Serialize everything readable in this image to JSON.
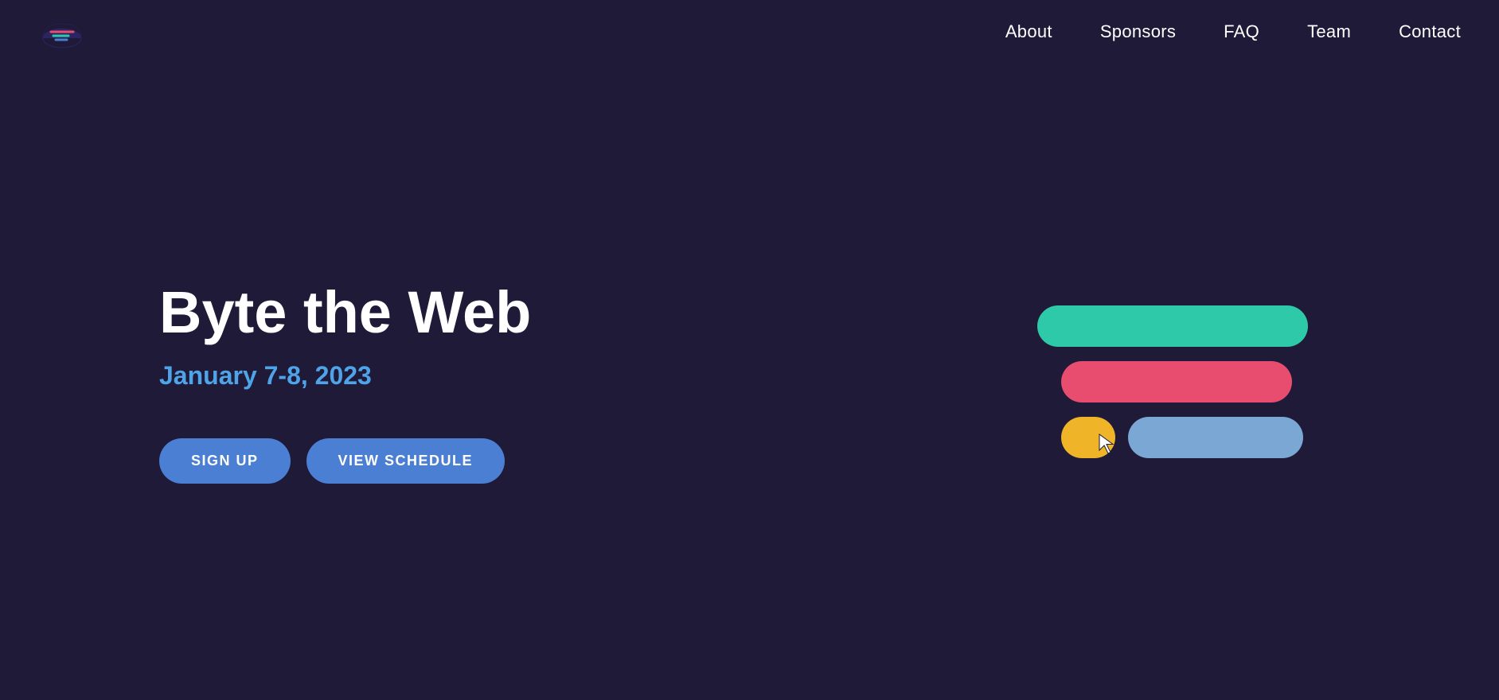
{
  "nav": {
    "logo_alt": "Byte the Web logo",
    "links": [
      {
        "label": "About",
        "href": "#about"
      },
      {
        "label": "Sponsors",
        "href": "#sponsors"
      },
      {
        "label": "FAQ",
        "href": "#faq"
      },
      {
        "label": "Team",
        "href": "#team"
      },
      {
        "label": "Contact",
        "href": "#contact"
      }
    ]
  },
  "hero": {
    "title": "Byte the Web",
    "date": "January 7-8, 2023",
    "cta_signup": "SIGN UP",
    "cta_schedule": "VIEW SCHEDULE"
  },
  "colors": {
    "background": "#1e1a38",
    "bar_teal": "#2ec9a8",
    "bar_pink": "#e84c6e",
    "bar_yellow": "#f0b429",
    "bar_blue": "#7ba7d4",
    "nav_link": "#ffffff",
    "hero_date": "#4fa3e8",
    "button": "#4a7fd4"
  }
}
